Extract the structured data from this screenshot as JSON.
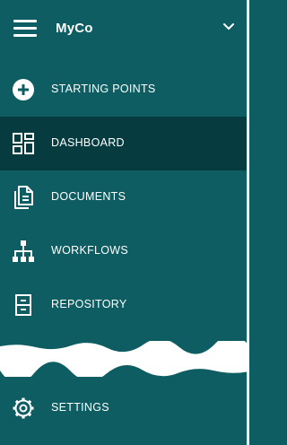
{
  "header": {
    "brand": "MyCo",
    "menu_icon": "hamburger-icon",
    "expand_icon": "chevron-down-icon"
  },
  "nav": {
    "items": [
      {
        "label": "STARTING POINTS",
        "icon": "plus-circle-icon",
        "active": false
      },
      {
        "label": "DASHBOARD",
        "icon": "dashboard-icon",
        "active": true
      },
      {
        "label": "DOCUMENTS",
        "icon": "documents-icon",
        "active": false
      },
      {
        "label": "WORKFLOWS",
        "icon": "workflow-icon",
        "active": false
      },
      {
        "label": "REPOSITORY",
        "icon": "repository-icon",
        "active": false
      },
      {
        "label": "SETTINGS",
        "icon": "gear-icon",
        "active": false
      }
    ]
  },
  "colors": {
    "sidebar_bg": "#0d5d62",
    "active_bg": "#063c40",
    "text": "#ffffff"
  }
}
